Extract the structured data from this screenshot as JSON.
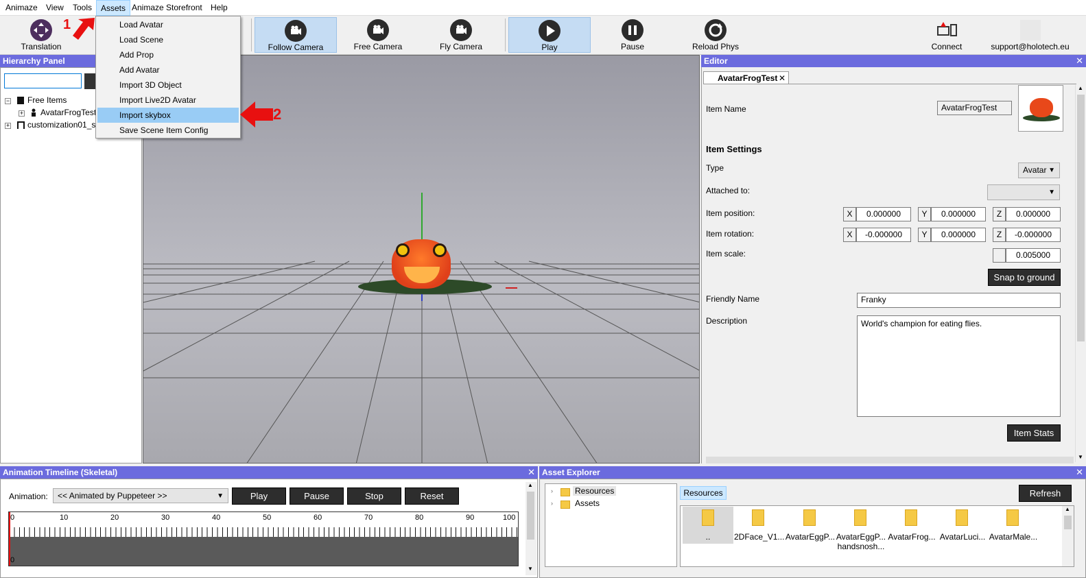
{
  "menubar": {
    "items": [
      "Animaze",
      "View",
      "Tools",
      "Assets",
      "Animaze Storefront",
      "Help"
    ]
  },
  "toolbar": {
    "translation": "Translation",
    "follow_camera": "Follow Camera",
    "free_camera": "Free Camera",
    "fly_camera": "Fly Camera",
    "play": "Play",
    "pause": "Pause",
    "reload_phys": "Reload Phys",
    "connect": "Connect",
    "support": "support@holotech.eu"
  },
  "annotations": {
    "arrow1": "1",
    "arrow2": "2"
  },
  "assets_menu": {
    "items": [
      "Load Avatar",
      "Load Scene",
      "Add Prop",
      "Add Avatar",
      "Import 3D Object",
      "Import Live2D Avatar",
      "Import skybox",
      "Save Scene Item Config"
    ],
    "highlighted_index": 6
  },
  "hierarchy": {
    "title": "Hierarchy Panel",
    "search_value": "",
    "tree": [
      "Free Items",
      "AvatarFrogTest",
      "customization01_sc"
    ]
  },
  "editor": {
    "title": "Editor",
    "close": "✕",
    "tab": "AvatarFrogTest",
    "item_name_label": "Item Name",
    "item_name": "AvatarFrogTest",
    "settings_heading": "Item Settings",
    "type_label": "Type",
    "type_value": "Avatar",
    "attached_label": "Attached to:",
    "attached_value": "",
    "position_label": "Item position:",
    "position": {
      "x": "0.000000",
      "y": "0.000000",
      "z": "0.000000"
    },
    "rotation_label": "Item rotation:",
    "rotation": {
      "x": "-0.000000",
      "y": "0.000000",
      "z": "-0.000000"
    },
    "scale_label": "Item scale:",
    "scale": "0.005000",
    "snap_button": "Snap to ground",
    "friendly_label": "Friendly Name",
    "friendly_value": "Franky",
    "description_label": "Description",
    "description_value": "World's champion for eating flies.",
    "stats_button": "Item Stats",
    "axes": {
      "x": "X",
      "y": "Y",
      "z": "Z"
    }
  },
  "timeline": {
    "title": "Animation Timeline (Skeletal)",
    "animation_label": "Animation:",
    "animation_value": "<< Animated by Puppeteer >>",
    "buttons": {
      "play": "Play",
      "pause": "Pause",
      "stop": "Stop",
      "reset": "Reset"
    },
    "ticks": [
      "0",
      "10",
      "20",
      "30",
      "40",
      "50",
      "60",
      "70",
      "80",
      "90",
      "100"
    ],
    "bottom_zero": "0"
  },
  "asset_explorer": {
    "title": "Asset Explorer",
    "tree": [
      "Resources",
      "Assets"
    ],
    "crumb": "Resources",
    "refresh": "Refresh",
    "folders": [
      "..",
      "2DFace_V1...",
      "AvatarEggP...",
      "AvatarEggP... handsnosh...",
      "AvatarFrog...",
      "AvatarLuci...",
      "AvatarMale..."
    ]
  },
  "colors": {
    "panel_header": "#6b6bde",
    "highlight": "#99ccf5",
    "arrow": "#e81010"
  }
}
